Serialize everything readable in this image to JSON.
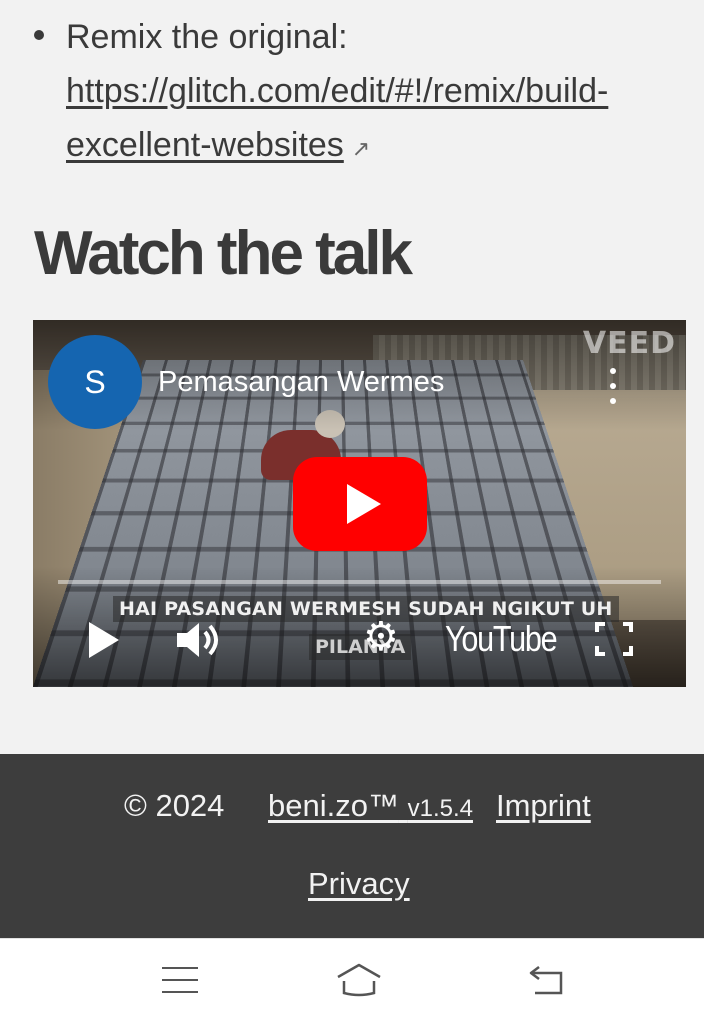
{
  "bullet": {
    "prefix": "Remix the original:",
    "link_line1": "https://glitch.com/edit/#!/remix/build-",
    "link_line2": "excellent-websites",
    "external_icon": "↗"
  },
  "section": {
    "heading": "Watch the talk"
  },
  "video": {
    "watermark": "VEED",
    "channel_initial": "S",
    "title": "Pemasangan Wermes",
    "caption_line1": "HAI PASANGAN WERMESH SUDAH NGIKUT UH",
    "caption_line2": "PILANYA",
    "logo": "YouTube",
    "play_button_color": "#ff0000",
    "avatar_color": "#1565b0",
    "icons": {
      "more": "more-vertical-icon",
      "play": "play-icon",
      "volume": "volume-icon",
      "settings": "gear-icon",
      "fullscreen": "fullscreen-icon"
    }
  },
  "footer": {
    "copyright": "© 2024",
    "brand": "beni.zo™",
    "version": "v1.5.4",
    "imprint": "Imprint",
    "privacy": "Privacy",
    "background": "#3d3d3d"
  },
  "navbar": {
    "icons": [
      "menu-icon",
      "home-icon",
      "back-icon"
    ]
  }
}
